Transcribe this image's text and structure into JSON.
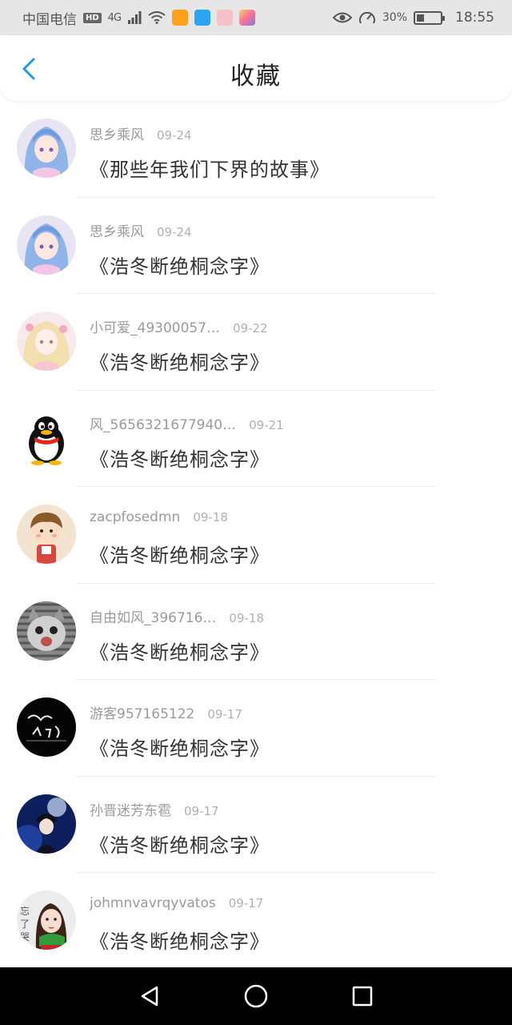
{
  "status_bar": {
    "carrier": "中国电信",
    "hd": "HD",
    "network": "4G",
    "battery": "30%",
    "battery_level": 0.3,
    "time": "18:55",
    "icons": [
      "signal-icon",
      "wifi-icon",
      "video-app-icon",
      "search-app-icon",
      "gift-app-icon",
      "store-app-icon",
      "eye-icon",
      "speed-icon"
    ]
  },
  "header": {
    "title": "收藏",
    "back_icon": "chevron-left-icon",
    "accent": "#2196f3"
  },
  "items": [
    {
      "user": "思乡乘风",
      "date": "09-24",
      "title": "《那些年我们下界的故事》",
      "avatar": "anime-blue-hair"
    },
    {
      "user": "思乡乘风",
      "date": "09-24",
      "title": "《浩冬断绝桐念字》",
      "avatar": "anime-blue-hair"
    },
    {
      "user": "小可爱_49300057…",
      "date": "09-22",
      "title": "《浩冬断绝桐念字》",
      "avatar": "anime-blonde"
    },
    {
      "user": "风_5656321677940…",
      "date": "09-21",
      "title": "《浩冬断绝桐念字》",
      "avatar": "qq-penguin"
    },
    {
      "user": "zacpfosedmn",
      "date": "09-18",
      "title": "《浩冬断绝桐念字》",
      "avatar": "cartoon-boy"
    },
    {
      "user": "自由如风_396716…",
      "date": "09-18",
      "title": "《浩冬断绝桐念字》",
      "avatar": "cat-photo"
    },
    {
      "user": "游客957165122",
      "date": "09-17",
      "title": "《浩冬断绝桐念字》",
      "avatar": "black-calligraphy"
    },
    {
      "user": "孙晋迷芳东雹",
      "date": "09-17",
      "title": "《浩冬断绝桐念字》",
      "avatar": "blue-night-photo"
    },
    {
      "user": "johmnvavrqyvatos",
      "date": "09-17",
      "title": "《浩冬断绝桐念字》",
      "avatar": "girl-green-scarf"
    }
  ],
  "nav": {
    "back_icon": "triangle-back-icon",
    "home_icon": "circle-home-icon",
    "recents_icon": "square-recents-icon"
  }
}
